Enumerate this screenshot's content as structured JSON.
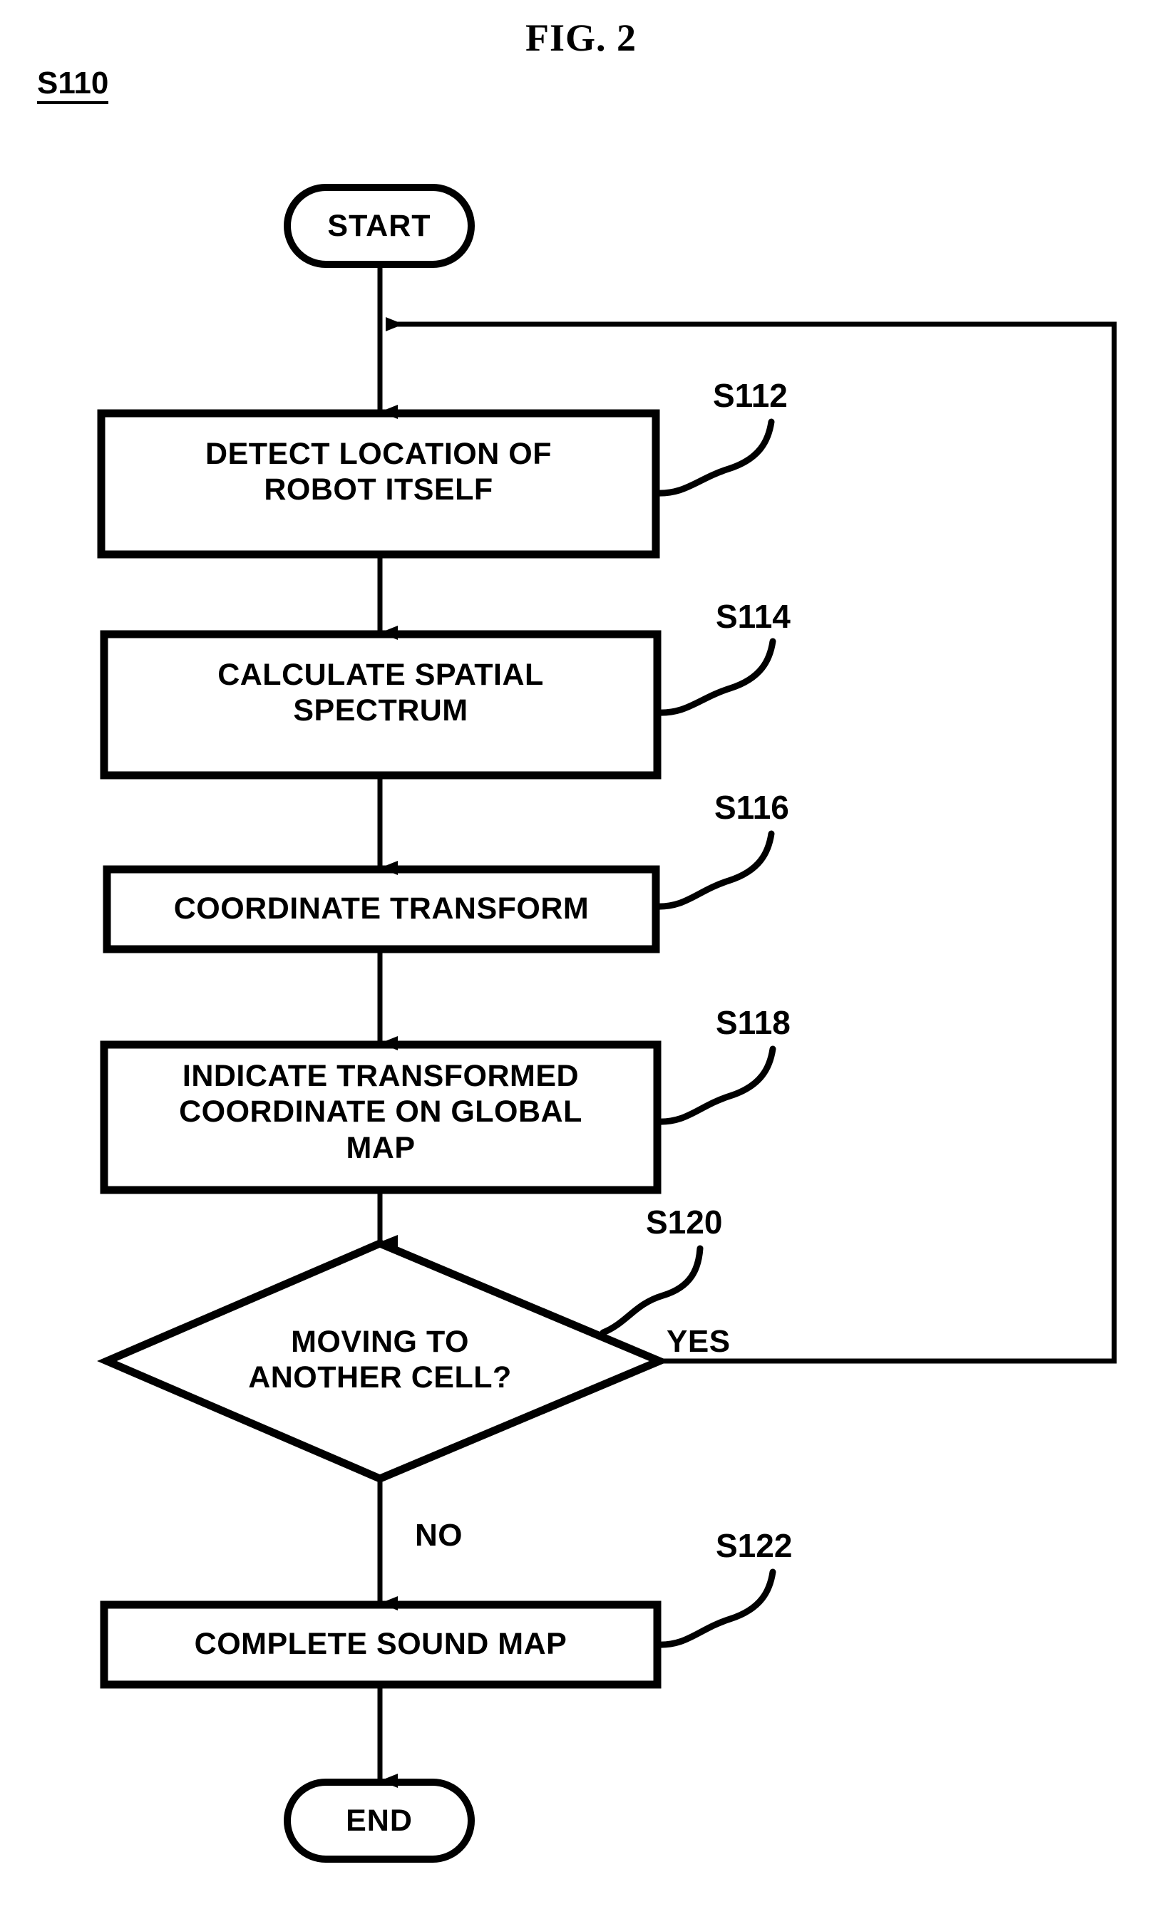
{
  "figure": {
    "title": "FIG. 2",
    "group_label": "S110"
  },
  "nodes": {
    "start": {
      "label": "START",
      "shape": "terminal"
    },
    "s112": {
      "line1": "DETECT LOCATION OF",
      "line2": "ROBOT ITSELF",
      "ref": "S112",
      "shape": "process"
    },
    "s114": {
      "line1": "CALCULATE SPATIAL",
      "line2": "SPECTRUM",
      "ref": "S114",
      "shape": "process"
    },
    "s116": {
      "line1": "COORDINATE TRANSFORM",
      "ref": "S116",
      "shape": "process"
    },
    "s118": {
      "line1": "INDICATE TRANSFORMED",
      "line2": "COORDINATE ON GLOBAL",
      "line3": "MAP",
      "ref": "S118",
      "shape": "process"
    },
    "s120": {
      "line1": "MOVING TO",
      "line2": "ANOTHER CELL?",
      "ref": "S120",
      "shape": "decision"
    },
    "s122": {
      "line1": "COMPLETE SOUND MAP",
      "ref": "S122",
      "shape": "process"
    },
    "end": {
      "label": "END",
      "shape": "terminal"
    }
  },
  "branches": {
    "yes": "YES",
    "no": "NO"
  },
  "colors": {
    "stroke": "#000000",
    "background": "#ffffff"
  },
  "chart_data": {
    "type": "flowchart",
    "title": "FIG. 2",
    "group": "S110",
    "steps": [
      {
        "id": "start",
        "type": "terminal",
        "text": "START"
      },
      {
        "id": "S112",
        "type": "process",
        "text": "DETECT LOCATION OF ROBOT ITSELF"
      },
      {
        "id": "S114",
        "type": "process",
        "text": "CALCULATE SPATIAL SPECTRUM"
      },
      {
        "id": "S116",
        "type": "process",
        "text": "COORDINATE TRANSFORM"
      },
      {
        "id": "S118",
        "type": "process",
        "text": "INDICATE TRANSFORMED COORDINATE ON GLOBAL MAP"
      },
      {
        "id": "S120",
        "type": "decision",
        "text": "MOVING TO ANOTHER CELL?"
      },
      {
        "id": "S122",
        "type": "process",
        "text": "COMPLETE SOUND MAP"
      },
      {
        "id": "end",
        "type": "terminal",
        "text": "END"
      }
    ],
    "edges": [
      {
        "from": "start",
        "to": "S112"
      },
      {
        "from": "S112",
        "to": "S114"
      },
      {
        "from": "S114",
        "to": "S116"
      },
      {
        "from": "S116",
        "to": "S118"
      },
      {
        "from": "S118",
        "to": "S120"
      },
      {
        "from": "S120",
        "to": "S122",
        "label": "NO"
      },
      {
        "from": "S120",
        "to": "S112",
        "label": "YES"
      },
      {
        "from": "S122",
        "to": "end"
      }
    ]
  }
}
